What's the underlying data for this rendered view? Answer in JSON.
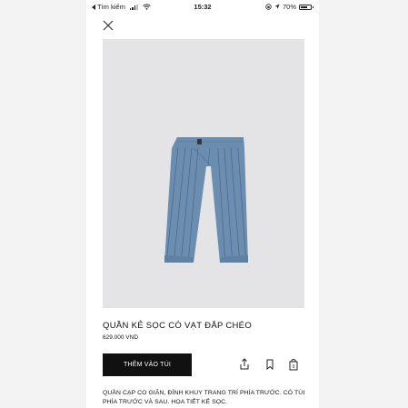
{
  "status_bar": {
    "back_label": "Tìm kiếm",
    "time": "15:32",
    "battery": "70%",
    "battery_level": 0.7
  },
  "product": {
    "title": "QUẦN KẺ SỌC CÓ VẠT ĐẮP CHÉO",
    "price": "629.000 VND",
    "add_to_cart_label": "THÊM VÀO TÚI",
    "description": "QUẦN CẠP CO GIÃN, ĐÍNH KHUY TRANG TRÍ PHÍA TRƯỚC. CÓ TÚI PHÍA TRƯỚC VÀ SAU. HỌA TIẾT KẺ SỌC."
  },
  "icons": {
    "close": "close-icon",
    "share": "share-icon",
    "bookmark": "bookmark-icon",
    "cart": "shopping-bag-icon"
  },
  "colors": {
    "pants": "#6b8db0",
    "image_bg": "#e4e4e6",
    "button_bg": "#111111",
    "button_text": "#ffffff"
  }
}
